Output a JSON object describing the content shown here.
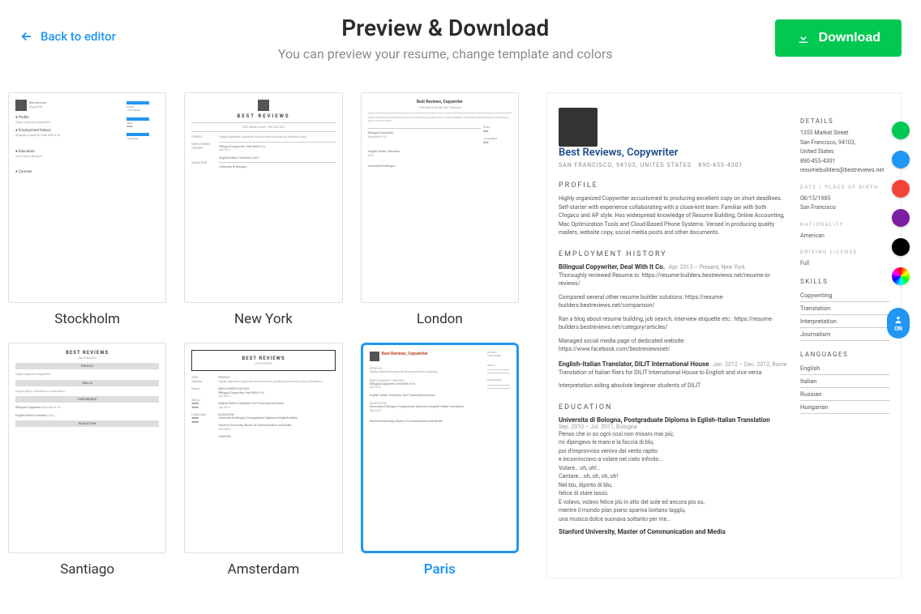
{
  "back_label": "Back to editor",
  "title": "Preview & Download",
  "subtitle": "You can preview your resume, change template and colors",
  "download_label": "Download",
  "templates": [
    {
      "name": "Stockholm"
    },
    {
      "name": "New York"
    },
    {
      "name": "London"
    },
    {
      "name": "Santiago"
    },
    {
      "name": "Amsterdam"
    },
    {
      "name": "Paris"
    }
  ],
  "selected_template": "Paris",
  "colors": [
    "#00C851",
    "#2196F3",
    "#F44336",
    "#7B1FA2",
    "#000000",
    "rainbow"
  ],
  "floater_label": "ON",
  "resume": {
    "name": "Best Reviews, Copywriter",
    "location_line": "SAN FRANCISCO, 94103, UNITED STATES",
    "phone": "890-455-4301",
    "details_h": "DETAILS",
    "details": [
      "1355 Market Street",
      "San Francisco, 94103,",
      "United States",
      "890-455-4301",
      "resumebuilders@bestreviews.net"
    ],
    "dob_h": "DATE / PLACE OF BIRTH",
    "dob": [
      "08/15/1985",
      "San Francisco"
    ],
    "nat_h": "NATIONALITY",
    "nat": "American",
    "lic_h": "DRIVING LICENSE",
    "lic": "Full",
    "profile_h": "PROFILE",
    "profile": "Highly organized Copywriter accustomed to producing excellent copy on short deadlines. Self-starter with experience collaborating with a close-knit team. Familiar with both Chigaco and AP style. Has widespread knowledge of Resume Building, Online Accounting, Mac Optimization Tools and Cloud-Based Phone Systems. Versed in producing quality mailers, website copy, social media posts and other documents.",
    "emp_h": "EMPLOYMENT HISTORY",
    "jobs": [
      {
        "title": "Bilingual Copywriter, Deal With It Co.",
        "date": "Apr. 2013 – Present, New York",
        "lines": [
          "Thoroughly reviewed Resume.io: https://resume-builders.bestreviews.net/resume-io-reviews/",
          "Compared several other resume builder solutions: https://resume-builders.bestreviews.net/comparison/",
          "Ran a blog about resume building, job search, interview etiquette etc.: https://resume-builders.bestreviews.net/category/articles/",
          "Managed social media page of dedicated website: https://www.facebook.com/bestreviewsnet/"
        ]
      },
      {
        "title": "English-Italian Translator, DILIT International House",
        "date": "Jan. 2012 – Dec. 2012, Rome",
        "lines": [
          "Translation of Italian fliers for DILIT International House to English and vice versa",
          "Interpretation aiding absolute beginner students of DILIT"
        ]
      }
    ],
    "edu_h": "EDUCATION",
    "edu": [
      {
        "title": "Universita di Bologna, Postgraduate Diploma in Eglish-Italian Translation",
        "date": "Sep. 2010 – Jul. 2011, Bologna",
        "lines": [
          "Penso che io so ogni così non misaro mai più;",
          "mi dipingevo le mani e la faccia di blu,",
          "poi d'improvviso venivo dal vento rapito",
          "e incominciavo a volare nel cielo infinito…",
          "Volare… oh, oh!…",
          "Cantare… oh, oh, oh, oh!",
          "Nel blu, dipinto di blu,",
          "felice di stare lassù.",
          "E volavo, volavo felice più in alto del sole ed ancora più su,",
          "mentre il mondo pian piano spariva lontano laggiù,",
          "una musica dolce suonava soltanto per me…"
        ]
      },
      {
        "title": "Stanford University, Master of Communication and Media",
        "date": "",
        "lines": []
      }
    ],
    "skills_h": "SKILLS",
    "skills": [
      "Copywriting",
      "Translation",
      "Interpretation",
      "Journalism"
    ],
    "lang_h": "LANGUAGES",
    "langs": [
      "English",
      "Italian",
      "Russian",
      "Hungarian"
    ]
  }
}
